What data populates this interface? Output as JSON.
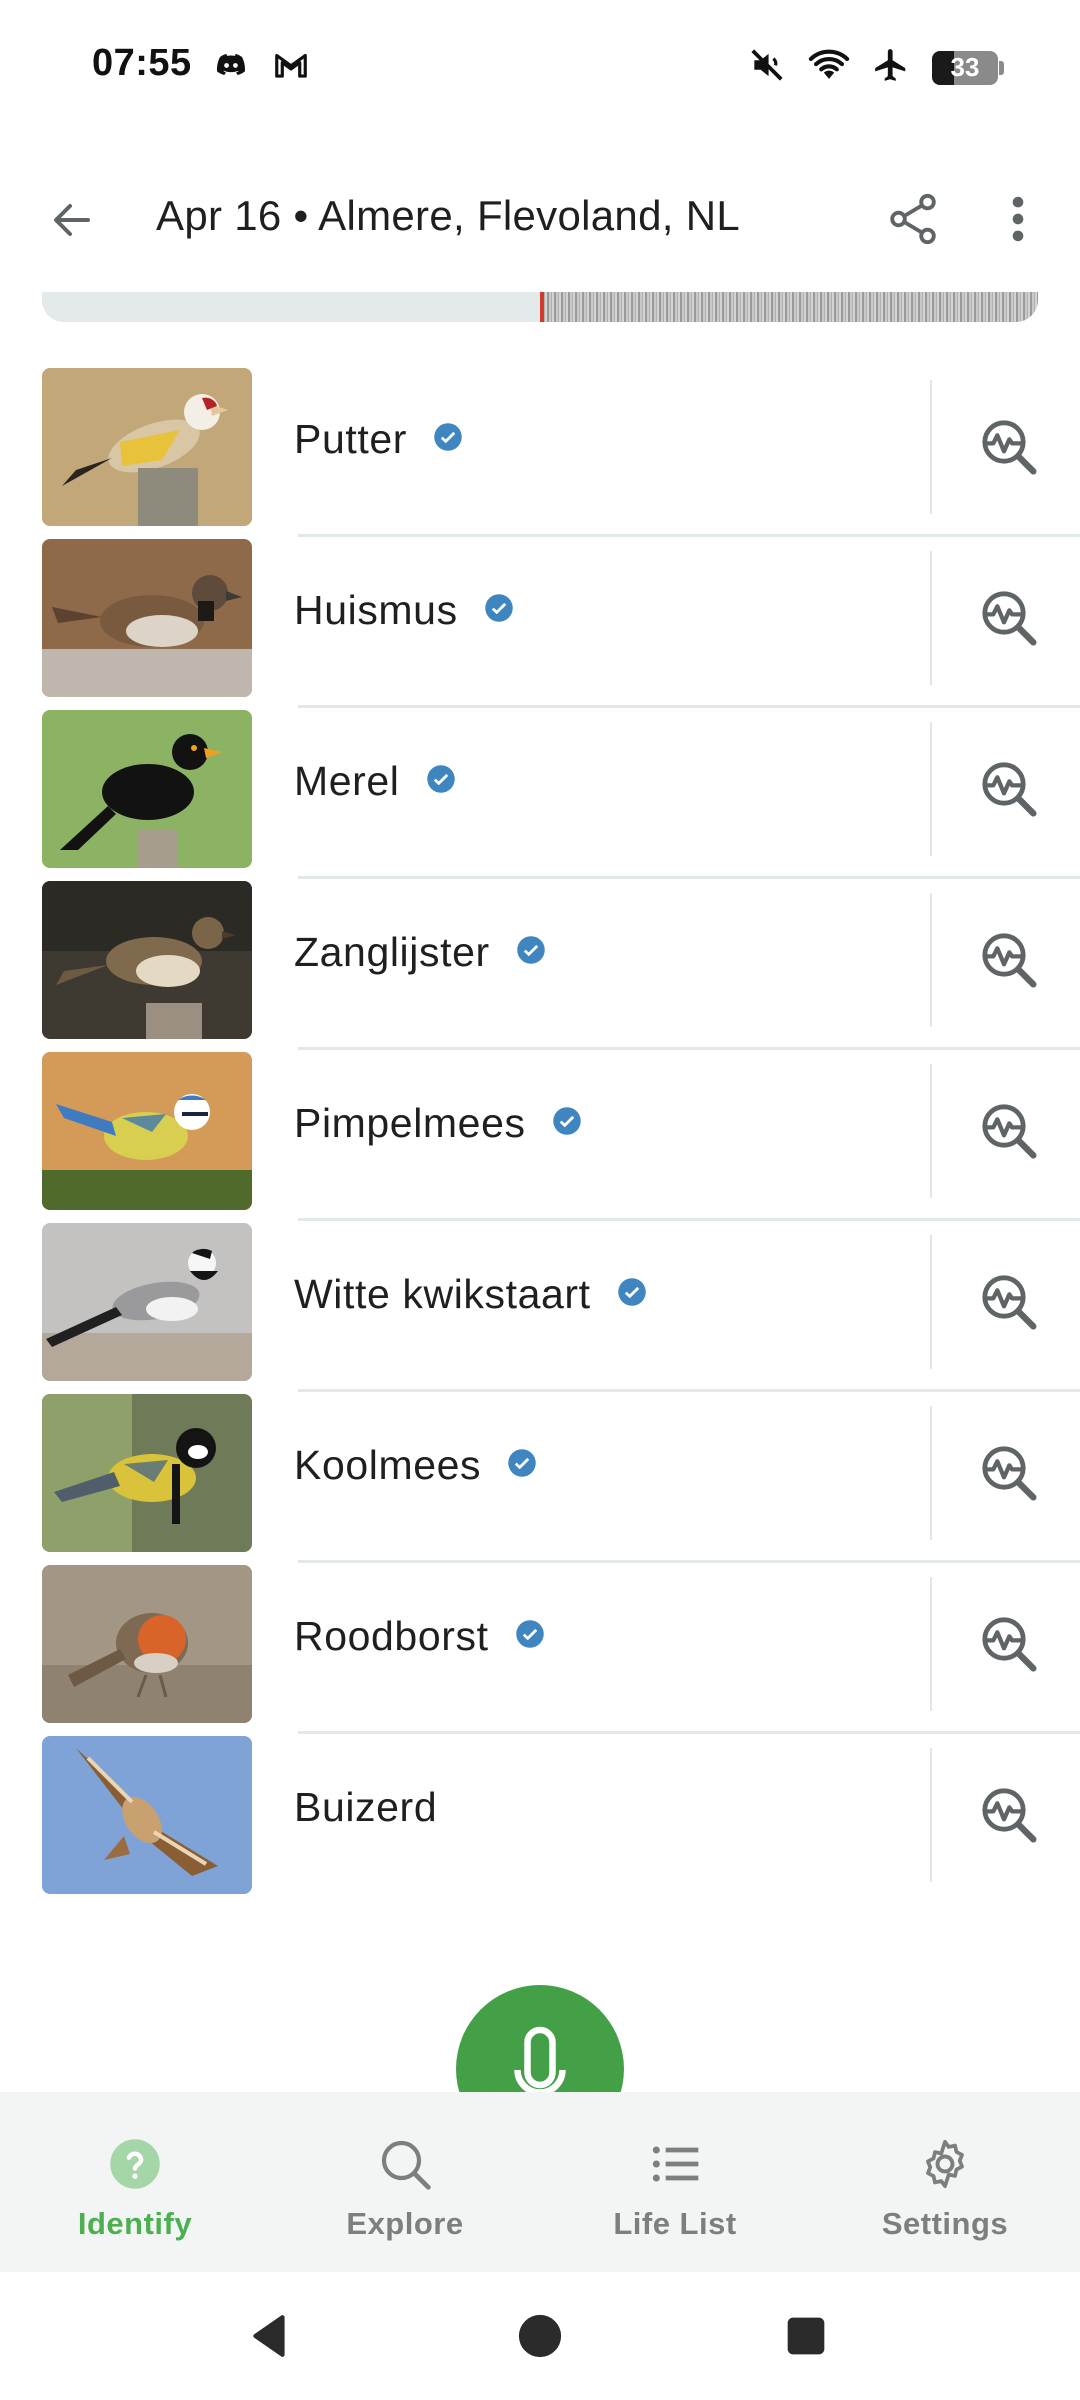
{
  "status_bar": {
    "time": "07:55",
    "battery": "33",
    "battery_fraction": 0.33,
    "left_icons": [
      "discord-icon",
      "gmail-icon"
    ],
    "right_icons": [
      "mute-icon",
      "wifi-icon",
      "airplane-icon",
      "battery-icon"
    ]
  },
  "header": {
    "title": "Apr 16 • Almere, Flevoland, NL"
  },
  "spectrogram": {
    "played_fraction": 0.5
  },
  "species": [
    {
      "name": "Putter",
      "verified": true
    },
    {
      "name": "Huismus",
      "verified": true
    },
    {
      "name": "Merel",
      "verified": true
    },
    {
      "name": "Zanglijster",
      "verified": true
    },
    {
      "name": "Pimpelmees",
      "verified": true
    },
    {
      "name": "Witte kwikstaart",
      "verified": true
    },
    {
      "name": "Koolmees",
      "verified": true
    },
    {
      "name": "Roodborst",
      "verified": true
    },
    {
      "name": "Buizerd",
      "verified": false
    }
  ],
  "bottom_nav": [
    {
      "label": "Identify",
      "icon": "identify-icon",
      "active": true
    },
    {
      "label": "Explore",
      "icon": "search-icon",
      "active": false
    },
    {
      "label": "Life List",
      "icon": "list-icon",
      "active": false
    },
    {
      "label": "Settings",
      "icon": "gear-icon",
      "active": false
    }
  ],
  "colors": {
    "accent_green": "#43a047",
    "verified_blue": "#3f86c0",
    "active_nav": "#4caf50"
  }
}
